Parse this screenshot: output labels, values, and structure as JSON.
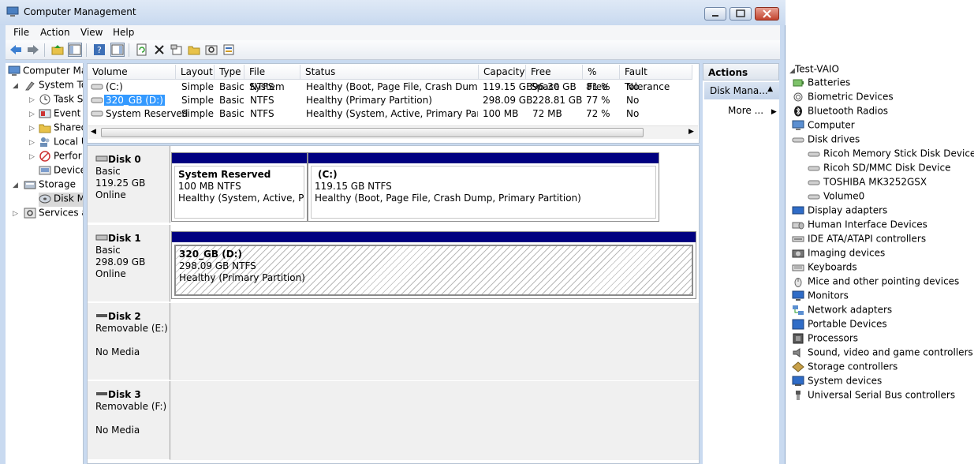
{
  "window": {
    "title": "Computer Management"
  },
  "menu": [
    "File",
    "Action",
    "View",
    "Help"
  ],
  "tree": {
    "root": "Computer Ma",
    "system_tools": "System To",
    "task_scheduler": "Task S",
    "event_viewer": "Event V",
    "shared_folders": "Shared",
    "local_users": "Local U",
    "performance": "Perfor",
    "device_manager": "Device",
    "storage": "Storage",
    "disk_management": "Disk M",
    "services": "Services ar"
  },
  "volume_list": {
    "columns": [
      "Volume",
      "Layout",
      "Type",
      "File System",
      "Status",
      "Capacity",
      "Free Space",
      "% Free",
      "Fault Tolerance"
    ],
    "rows": [
      {
        "volume": "(C:)",
        "layout": "Simple",
        "type": "Basic",
        "fs": "NTFS",
        "status": "Healthy (Boot, Page File, Crash Dump,...",
        "capacity": "119.15 GB",
        "free": "96.30 GB",
        "pct": "81 %",
        "fault": "No"
      },
      {
        "volume": "320_GB (D:)",
        "layout": "Simple",
        "type": "Basic",
        "fs": "NTFS",
        "status": "Healthy (Primary Partition)",
        "capacity": "298.09 GB",
        "free": "228.81 GB",
        "pct": "77 %",
        "fault": "No"
      },
      {
        "volume": "System Reserved",
        "layout": "Simple",
        "type": "Basic",
        "fs": "NTFS",
        "status": "Healthy (System, Active, Primary Partit...",
        "capacity": "100 MB",
        "free": "72 MB",
        "pct": "72 %",
        "fault": "No"
      }
    ]
  },
  "disks": [
    {
      "name": "Disk 0",
      "type": "Basic",
      "size": "119.25 GB",
      "state": "Online",
      "partitions": [
        {
          "title": "System Reserved",
          "size": "100 MB NTFS",
          "status": "Healthy (System, Active, Prima"
        },
        {
          "title": "(C:)",
          "size": "119.15 GB NTFS",
          "status": "Healthy (Boot, Page File, Crash Dump, Primary Partition)"
        }
      ]
    },
    {
      "name": "Disk 1",
      "type": "Basic",
      "size": "298.09 GB",
      "state": "Online",
      "partitions": [
        {
          "title": "320_GB  (D:)",
          "size": "298.09 GB NTFS",
          "status": "Healthy (Primary Partition)"
        }
      ]
    },
    {
      "name": "Disk 2",
      "type": "Removable (E:)",
      "state": "No Media"
    },
    {
      "name": "Disk 3",
      "type": "Removable (F:)",
      "state": "No Media"
    }
  ],
  "actions": {
    "header": "Actions",
    "item": "Disk Mana...",
    "more": "More ..."
  },
  "device_manager": {
    "computer_name": "Test-VAIO",
    "categories": [
      "Batteries",
      "Biometric Devices",
      "Bluetooth Radios",
      "Computer",
      "Disk drives"
    ],
    "disk_drives": [
      "Ricoh Memory Stick Disk Device",
      "Ricoh SD/MMC Disk Device",
      "TOSHIBA MK3252GSX",
      "Volume0"
    ],
    "categories2": [
      "Display adapters",
      "Human Interface Devices",
      "IDE ATA/ATAPI controllers",
      "Imaging devices",
      "Keyboards",
      "Mice and other pointing devices",
      "Monitors",
      "Network adapters",
      "Portable Devices",
      "Processors",
      "Sound, video and game controllers",
      "Storage controllers",
      "System devices",
      "Universal Serial Bus controllers"
    ]
  },
  "colors": {
    "partition_bar": "#000080",
    "selection": "#3399ff",
    "frame": "#c9daf0"
  }
}
